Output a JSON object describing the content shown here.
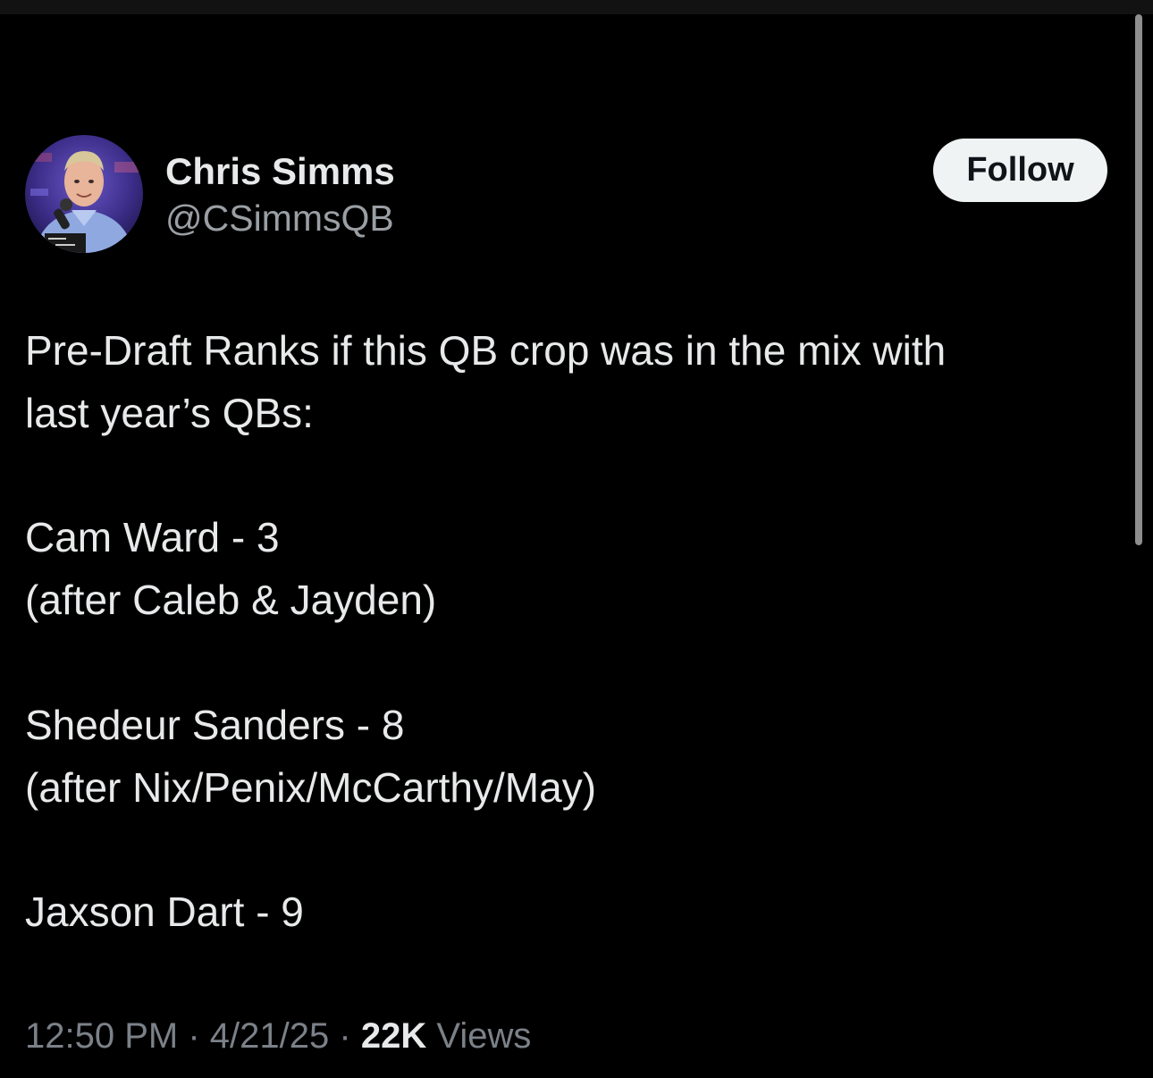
{
  "author": {
    "display_name": "Chris Simms",
    "handle": "@CSimmsQB"
  },
  "follow_label": "Follow",
  "tweet": {
    "lines": [
      "Pre-Draft Ranks if this QB crop was in the mix with",
      "last year’s QBs:",
      "Cam Ward - 3",
      "(after Caleb & Jayden)",
      "Shedeur Sanders - 8",
      "(after Nix/Penix/McCarthy/May)",
      "Jaxson Dart - 9"
    ]
  },
  "meta": {
    "time": "12:50 PM",
    "separator": "·",
    "date": "4/21/25",
    "views_count": "22K",
    "views_label": "Views"
  },
  "colors": {
    "background": "#000000",
    "text": "#e7e9ea",
    "secondary_text": "#9a9fa4",
    "follow_bg": "#eff3f4"
  }
}
